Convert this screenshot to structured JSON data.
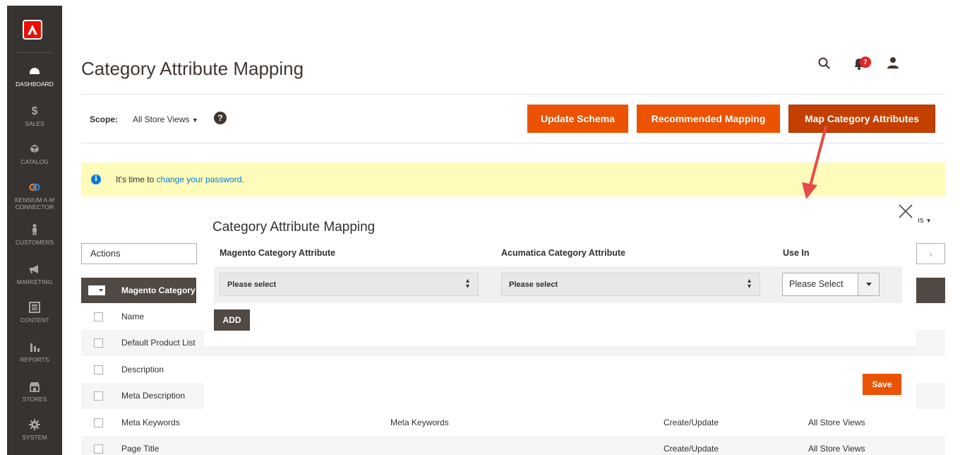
{
  "sidebar": {
    "items": [
      {
        "label": "DASHBOARD",
        "icon": "dashboard-icon"
      },
      {
        "label": "SALES",
        "icon": "dollar-icon"
      },
      {
        "label": "CATALOG",
        "icon": "cube-icon"
      },
      {
        "label_line1": "KENSIUM A-M",
        "label_line2": "CONNECTOR",
        "icon": "connector-icon"
      },
      {
        "label": "CUSTOMERS",
        "icon": "person-icon"
      },
      {
        "label": "MARKETING",
        "icon": "megaphone-icon"
      },
      {
        "label": "CONTENT",
        "icon": "content-icon"
      },
      {
        "label": "REPORTS",
        "icon": "bar-chart-icon"
      },
      {
        "label": "STORES",
        "icon": "store-icon"
      },
      {
        "label": "SYSTEM",
        "icon": "gear-icon"
      }
    ]
  },
  "header": {
    "title": "Category Attribute Mapping",
    "notification_count": "7"
  },
  "toolbar": {
    "scope_label": "Scope:",
    "scope_value": "All Store Views",
    "help": "?",
    "update_schema": "Update Schema",
    "recommended_mapping": "Recommended Mapping",
    "map_category_attributes": "Map Category Attributes"
  },
  "notice": {
    "prefix": "It's time to ",
    "link": "change your password",
    "suffix": "."
  },
  "grid": {
    "actions_label": "Actions",
    "header_first_col": "Magento Category",
    "columns_label": "ıs",
    "rows": [
      {
        "c1": "Name",
        "c2": "",
        "c3": "",
        "c4": ""
      },
      {
        "c1": "Default Product List",
        "c2": "",
        "c3": "",
        "c4": ""
      },
      {
        "c1": "Description",
        "c2": "",
        "c3": "",
        "c4": ""
      },
      {
        "c1": "Meta Description",
        "c2": "",
        "c3": "",
        "c4": ""
      },
      {
        "c1": "Meta Keywords",
        "c2": "Meta Keywords",
        "c3": "Create/Update",
        "c4": "All Store Views"
      },
      {
        "c1": "Page Title",
        "c2": "",
        "c3": "Create/Update",
        "c4": "All Store Views"
      }
    ]
  },
  "modal": {
    "title": "Category Attribute Mapping",
    "col_magento": "Magento Category Attribute",
    "col_acumatica": "Acumatica Category Attribute",
    "col_use_in": "Use In",
    "magento_select": "Please select",
    "acumatica_select": "Please select",
    "use_in_select": "Please Select",
    "add_label": "ADD",
    "save_label": "Save"
  },
  "colors": {
    "sidebar": "#373330",
    "accent": "#eb5202",
    "notice": "#fffbbb",
    "arrow": "#e84a4a"
  }
}
